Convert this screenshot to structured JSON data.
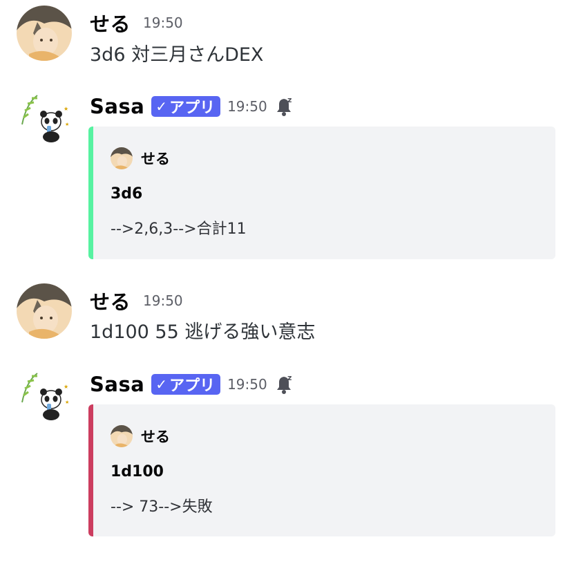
{
  "messages": [
    {
      "author": "せる",
      "time": "19:50",
      "text": "3d6 対三月さんDEX"
    },
    {
      "author": "Sasa",
      "badge": "アプリ",
      "time": "19:50",
      "embed": {
        "author": "せる",
        "title": "3d6",
        "description": "-->2,6,3-->合計11",
        "color": "#57f2a1"
      }
    },
    {
      "author": "せる",
      "time": "19:50",
      "text": "1d100 55 逃げる強い意志"
    },
    {
      "author": "Sasa",
      "badge": "アプリ",
      "time": "19:50",
      "embed": {
        "author": "せる",
        "title": "1d100",
        "description": "--> 73-->失敗",
        "color": "#cc3d5f"
      }
    }
  ],
  "colors": {
    "badge": "#5865f2",
    "embed_bg": "#f2f3f5"
  },
  "icons": {
    "verified": "checkmark-icon",
    "sleep": "bell-sleep-icon"
  }
}
